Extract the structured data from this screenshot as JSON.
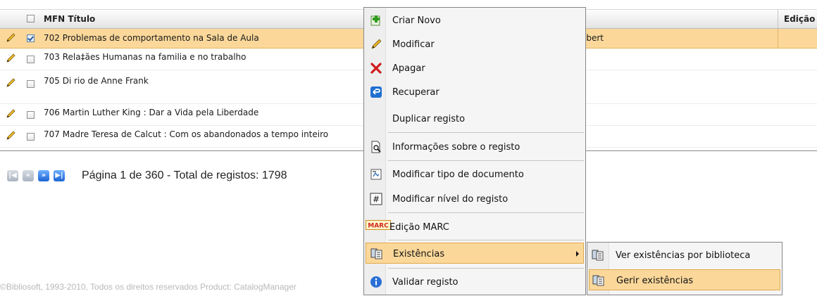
{
  "grid": {
    "columns": {
      "title": "MFN Título",
      "edition": "Edição"
    },
    "rows": [
      {
        "text": "702 Problemas de comportamento na Sala de Aula",
        "extra": "obert",
        "selected": true,
        "checked": true
      },
      {
        "text": "703 Rela‡ães Humanas na familia e no trabalho",
        "extra": "",
        "selected": false,
        "checked": false
      },
      {
        "text": "705 Di rio de Anne Frank",
        "extra": "",
        "selected": false,
        "checked": false
      },
      {
        "text": "706 Martin Luther King : Dar a Vida pela Liberdade",
        "extra": "",
        "selected": false,
        "checked": false
      },
      {
        "text": "707 Madre Teresa de Calcut : Com os abandonados a tempo inteiro",
        "extra": "",
        "selected": false,
        "checked": false
      }
    ]
  },
  "pager": {
    "text": "Página 1 de 360 - Total de registos: 1798"
  },
  "footer": {
    "text": "©Bibliosoft, 1993-2010, Todos os direitos reservados Product: CatalogManager"
  },
  "context_menu": {
    "items": [
      {
        "label": "Criar Novo",
        "icon": "add-record-icon"
      },
      {
        "label": "Modificar",
        "icon": "pencil-icon"
      },
      {
        "label": "Apagar",
        "icon": "delete-x-icon"
      },
      {
        "label": "Recuperar",
        "icon": "recover-icon"
      },
      {
        "label": "Duplicar registo",
        "icon": ""
      },
      {
        "label": "Informações sobre o registo",
        "icon": "document-magnifier-icon"
      },
      {
        "label": "Modificar tipo de documento",
        "icon": "document-type-icon"
      },
      {
        "label": "Modificar nível do registo",
        "icon": "hash-level-icon"
      },
      {
        "label": "Edição MARC",
        "icon": "marc-icon"
      },
      {
        "label": "Existências",
        "icon": "holdings-icon"
      },
      {
        "label": "Validar registo",
        "icon": "info-icon"
      }
    ],
    "marc_badge": "MARC",
    "hash_glyph": "#"
  },
  "submenu": {
    "items": [
      {
        "label": "Ver existências por biblioteca",
        "icon": "holdings-icon"
      },
      {
        "label": "Gerir existências",
        "icon": "holdings-icon"
      }
    ]
  },
  "colors": {
    "selection": "#fbd89a",
    "selection_border": "#e0a94a",
    "menu_bg": "#f5f5f5",
    "pager_blue": "#1c64d3"
  }
}
